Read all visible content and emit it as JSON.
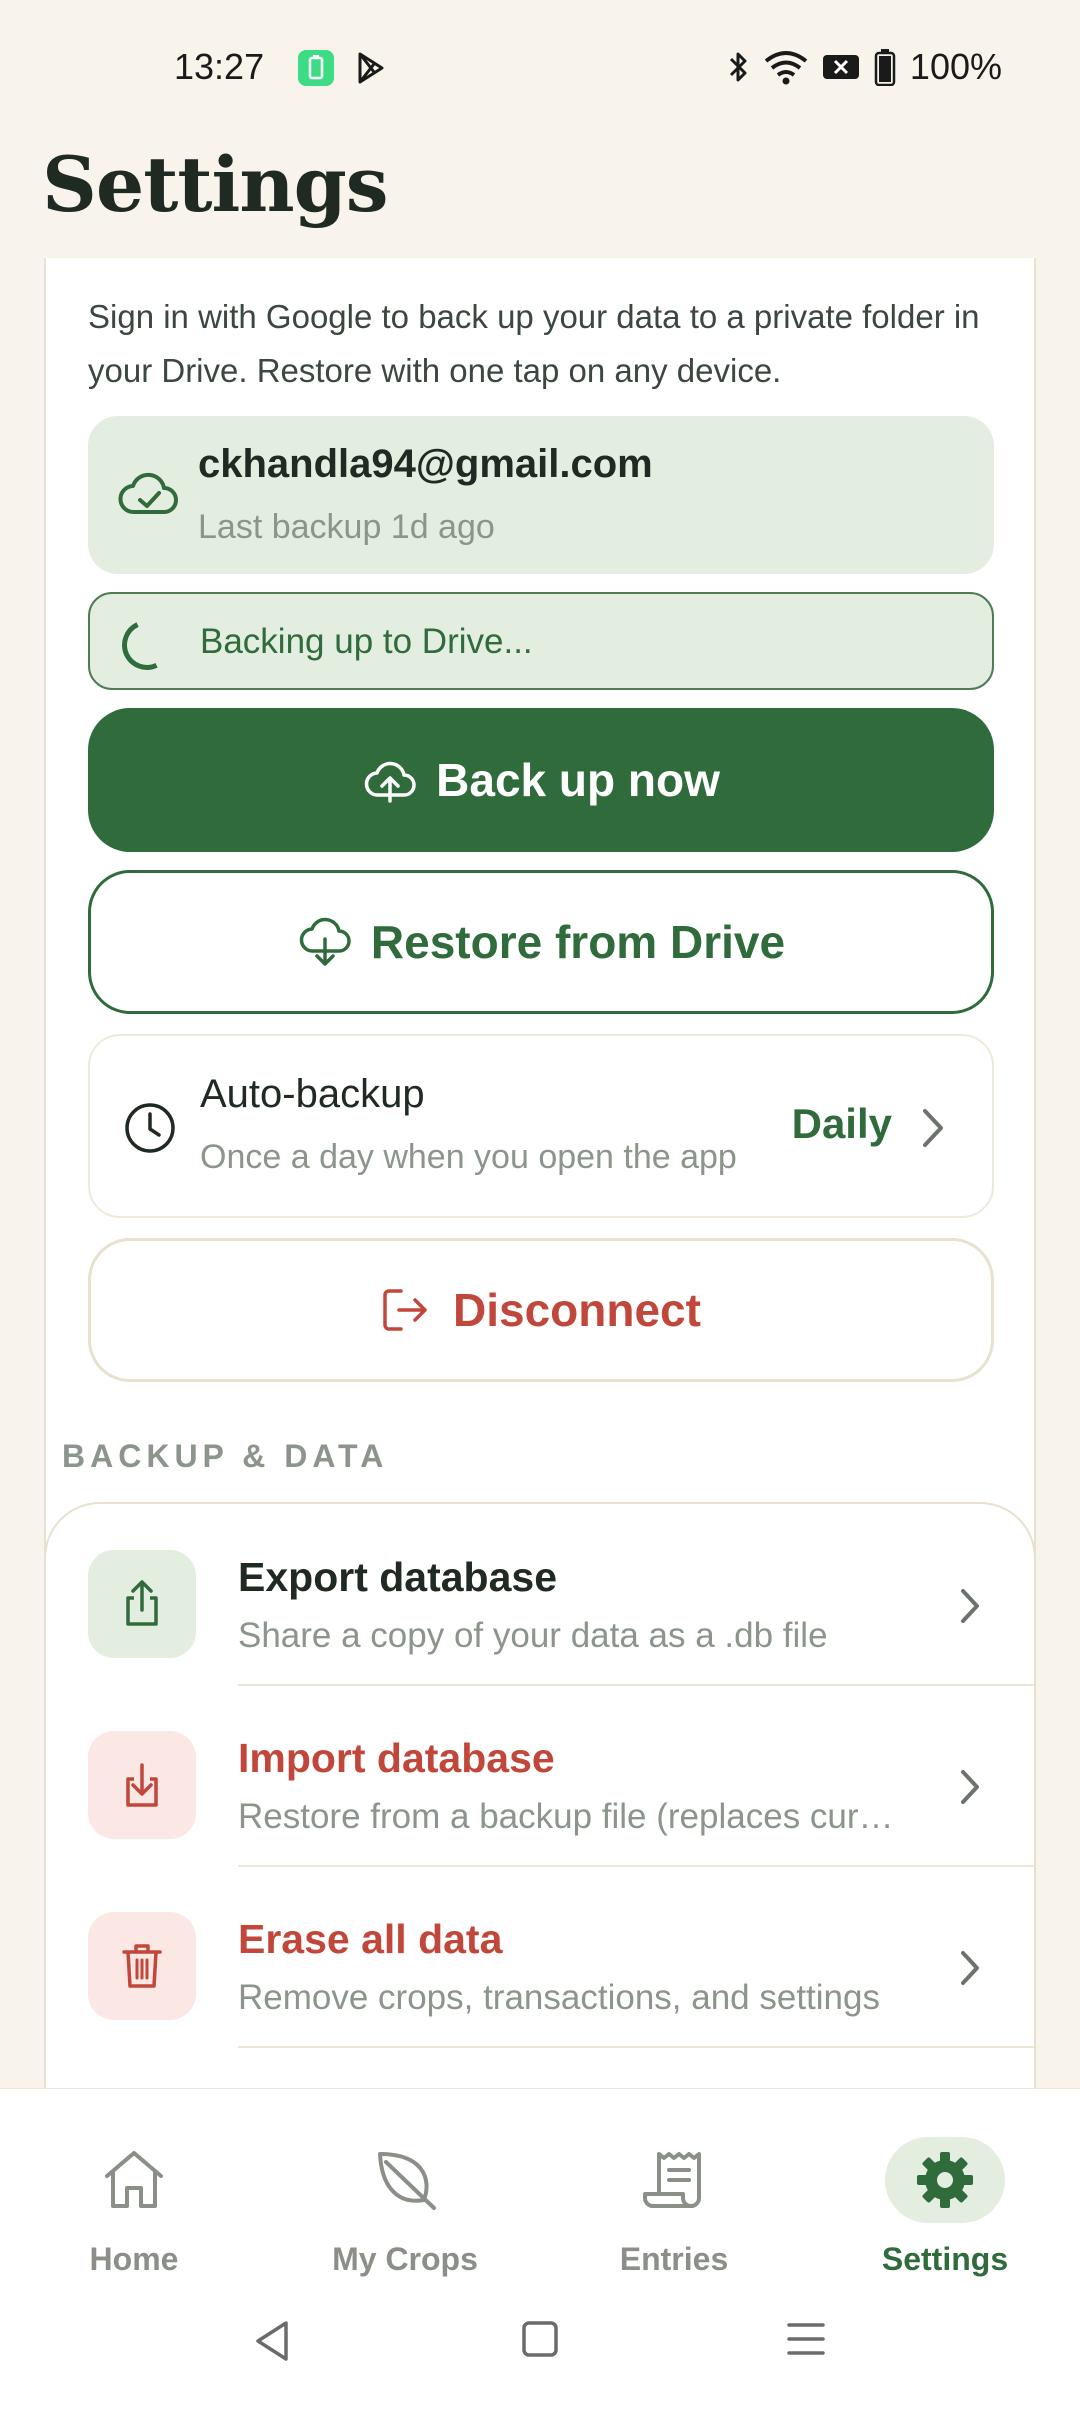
{
  "status_bar": {
    "time": "13:27",
    "battery": "100%"
  },
  "page": {
    "title": "Settings"
  },
  "drive_card": {
    "description": "Sign in with Google to back up your data to a private folder in your Drive. Restore with one tap on any device.",
    "account_email": "ckhandla94@gmail.com",
    "last_backup": "Last backup 1d ago",
    "progress_text": "Backing up to Drive...",
    "backup_button": "Back up now",
    "restore_button": "Restore from Drive",
    "auto_backup": {
      "title": "Auto-backup",
      "subtitle": "Once a day when you open the app",
      "value": "Daily"
    },
    "disconnect_button": "Disconnect"
  },
  "backup_section": {
    "header": "BACKUP & DATA",
    "rows": [
      {
        "title": "Export database",
        "subtitle": "Share a copy of your data as a .db file",
        "icon": "share-icon"
      },
      {
        "title": "Import database",
        "subtitle": "Restore from a backup file (replaces current data)",
        "icon": "download-icon"
      },
      {
        "title": "Erase all data",
        "subtitle": "Remove crops, transactions, and settings",
        "icon": "trash-icon"
      }
    ]
  },
  "bottom_nav": {
    "items": [
      {
        "label": "Home",
        "icon": "home-icon"
      },
      {
        "label": "My Crops",
        "icon": "leaf-icon"
      },
      {
        "label": "Entries",
        "icon": "receipt-icon"
      },
      {
        "label": "Settings",
        "icon": "gear-icon",
        "active": true
      }
    ]
  },
  "colors": {
    "accent": "#2f6b3b",
    "danger": "#c1473b",
    "background": "#f8f4ec"
  }
}
